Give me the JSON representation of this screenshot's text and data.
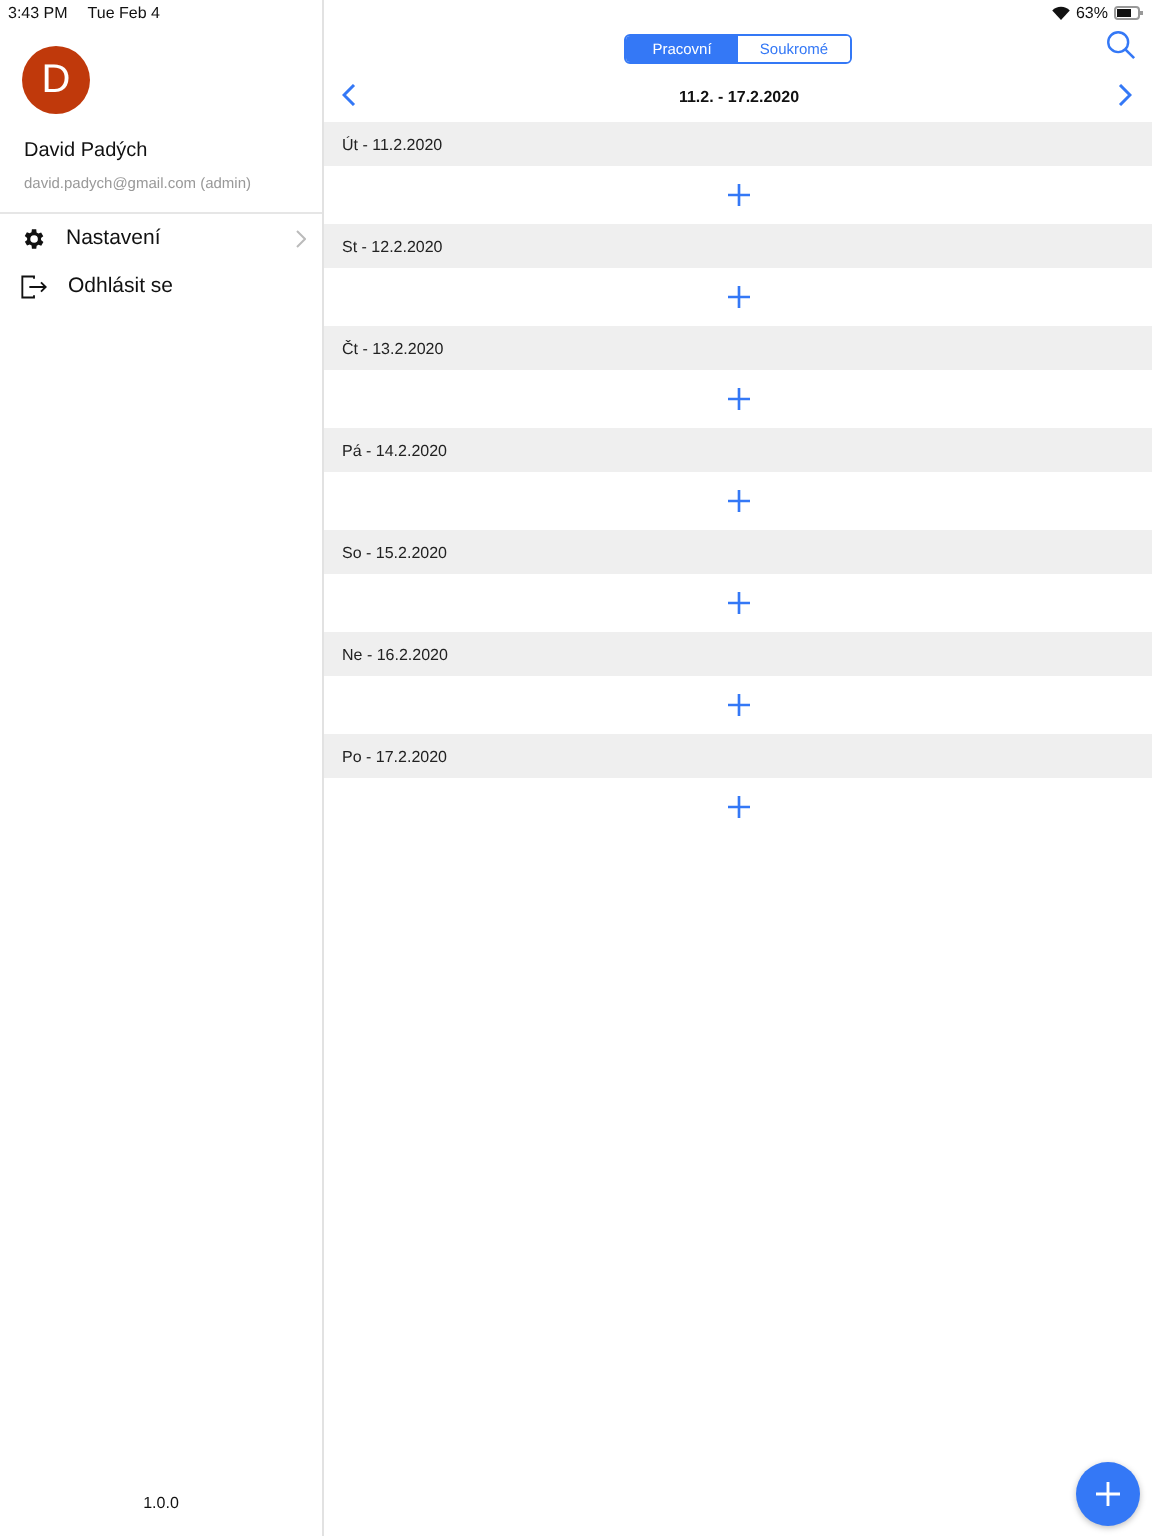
{
  "status_bar": {
    "time": "3:43 PM",
    "date": "Tue Feb 4",
    "battery_text": "63%"
  },
  "sidebar": {
    "avatar_letter": "D",
    "user_name": "David Padých",
    "user_email": "david.padych@gmail.com (admin)",
    "items": [
      {
        "kind": "settings",
        "label": "Nastavení",
        "has_chevron": true
      },
      {
        "kind": "logout",
        "label": "Odhlásit se",
        "has_chevron": false
      }
    ],
    "version": "1.0.0"
  },
  "segments": [
    {
      "label": "Pracovní",
      "selected": true
    },
    {
      "label": "Soukromé",
      "selected": false
    }
  ],
  "week_range": "11.2. - 17.2.2020",
  "days": [
    {
      "label": "Út - 11.2.2020"
    },
    {
      "label": "St - 12.2.2020"
    },
    {
      "label": "Čt - 13.2.2020"
    },
    {
      "label": "Pá - 14.2.2020"
    },
    {
      "label": "So - 15.2.2020"
    },
    {
      "label": "Ne - 16.2.2020"
    },
    {
      "label": "Po - 17.2.2020"
    }
  ]
}
